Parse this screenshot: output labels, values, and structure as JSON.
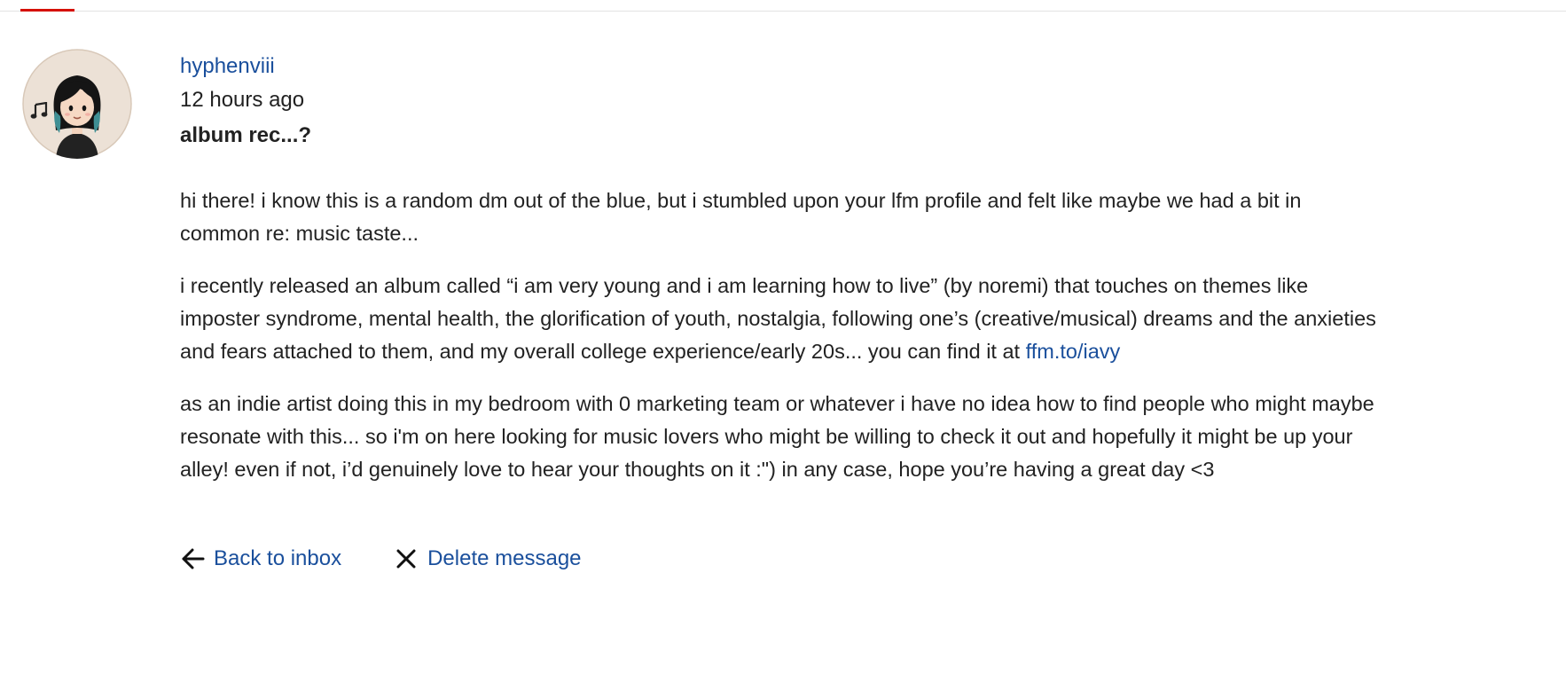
{
  "colors": {
    "link": "#1a4f9c",
    "text": "#222222",
    "accent": "#d51007",
    "avatar_bg": "#ece1d6"
  },
  "message": {
    "author": "hyphenviii",
    "timestamp": "12 hours ago",
    "subject": "album rec...?",
    "paragraph_1": "hi there! i know this is a random dm out of the blue, but i stumbled upon your lfm profile and felt like maybe we had a bit in common re: music taste...",
    "paragraph_2_text": "i recently released an album called “i am very young and i am learning how to live” (by noremi) that touches on themes like imposter syndrome, mental health, the glorification of youth, nostalgia, following one’s (creative/musical) dreams and the anxieties and fears attached to them, and my overall college experience/early 20s... you can find it at ",
    "paragraph_2_link": "ffm.to/iavy",
    "paragraph_3": "as an indie artist doing this in my bedroom with 0 marketing team or whatever i have no idea how to find people who might maybe resonate with this... so i'm on here looking for music lovers who might be willing to check it out and hopefully it might be up your alley! even if not, i’d genuinely love to hear your thoughts on it :\") in any case, hope you’re having a great day <3"
  },
  "actions": {
    "back_label": "Back to inbox",
    "back_icon": "arrow-left-icon",
    "delete_label": "Delete message",
    "delete_icon": "close-icon"
  },
  "avatar": {
    "icon": "music-note-icon"
  }
}
